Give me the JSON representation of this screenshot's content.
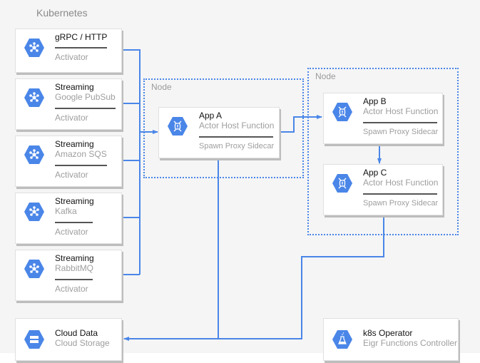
{
  "zone": {
    "label": "Kubernetes"
  },
  "nodes": [
    {
      "label": "Node"
    },
    {
      "label": "Node"
    }
  ],
  "colors": {
    "accent": "#4a86e8",
    "icon": "#4a86e8",
    "zone_bg": "#f5f5f5"
  },
  "activators": [
    {
      "title": "gRPC / HTTP",
      "subtitle": "",
      "footer": "Activator",
      "icon": "hub-icon"
    },
    {
      "title": "Streaming",
      "subtitle": "Google PubSub",
      "footer": "Activator",
      "icon": "hub-icon"
    },
    {
      "title": "Streaming",
      "subtitle": "Amazon SQS",
      "footer": "Activator",
      "icon": "hub-icon"
    },
    {
      "title": "Streaming",
      "subtitle": "Kafka",
      "footer": "Activator",
      "icon": "hub-icon"
    },
    {
      "title": "Streaming",
      "subtitle": "RabbitMQ",
      "footer": "Activator",
      "icon": "hub-icon"
    }
  ],
  "apps": [
    {
      "title": "App A",
      "subtitle": "Actor Host Function",
      "footer": "Spawn Proxy Sidecar",
      "icon": "container-icon"
    },
    {
      "title": "App B",
      "subtitle": "Actor Host Function",
      "footer": "Spawn Proxy Sidecar",
      "icon": "container-icon"
    },
    {
      "title": "App C",
      "subtitle": "Actor Host Function",
      "footer": "Spawn Proxy Sidecar",
      "icon": "container-icon"
    }
  ],
  "storage": {
    "title": "Cloud Data",
    "subtitle": "Cloud Storage",
    "icon": "storage-icon"
  },
  "operator": {
    "title": "k8s Operator",
    "subtitle": "Eigr Functions Controller",
    "icon": "flask-icon"
  }
}
